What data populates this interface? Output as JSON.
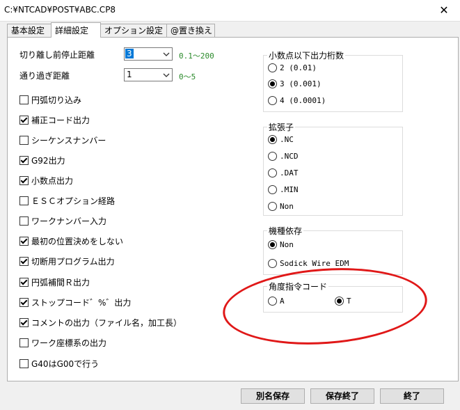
{
  "window": {
    "title": "C:¥NTCAD¥POST¥ABC.CP8",
    "close_glyph": "✕"
  },
  "tabs": [
    {
      "label": "基本設定",
      "active": false
    },
    {
      "label": "詳細設定",
      "active": true
    },
    {
      "label": "オプション設定",
      "active": false
    },
    {
      "label": "@置き換え",
      "active": false
    }
  ],
  "fields": {
    "cut_stop_distance": {
      "label": "切り離し前停止距離",
      "value": "3",
      "range": "0.1～200"
    },
    "overshoot_distance": {
      "label": "通り過ぎ距離",
      "value": "1",
      "range": "0～5"
    }
  },
  "checkboxes": [
    {
      "label": "円弧切り込み",
      "checked": false
    },
    {
      "label": "補正コード出力",
      "checked": true
    },
    {
      "label": "シーケンスナンバー",
      "checked": false
    },
    {
      "label": "G92出力",
      "checked": true
    },
    {
      "label": "小数点出力",
      "checked": true
    },
    {
      "label": "ＥＳＣオプション経路",
      "checked": false
    },
    {
      "label": "ワークナンバー入力",
      "checked": false
    },
    {
      "label": "最初の位置決めをしない",
      "checked": true
    },
    {
      "label": "切断用プログラム出力",
      "checked": true
    },
    {
      "label": "円弧補間Ｒ出力",
      "checked": true
    },
    {
      "label": "ストップコード゛%゛出力",
      "checked": true
    },
    {
      "label": "コメントの出力（ファイル名，加工長）",
      "checked": true
    },
    {
      "label": "ワーク座標系の出力",
      "checked": false
    },
    {
      "label": "G40はG00で行う",
      "checked": false
    }
  ],
  "decimal_group": {
    "title": "小数点以下出力桁数",
    "options": [
      {
        "label": "2 (0.01)",
        "selected": false
      },
      {
        "label": "3 (0.001)",
        "selected": true
      },
      {
        "label": "4 (0.0001)",
        "selected": false
      }
    ]
  },
  "extension_group": {
    "title": "拡張子",
    "options": [
      {
        "label": ".NC",
        "selected": true
      },
      {
        "label": ".NCD",
        "selected": false
      },
      {
        "label": ".DAT",
        "selected": false
      },
      {
        "label": ".MIN",
        "selected": false
      },
      {
        "label": "Non",
        "selected": false
      }
    ]
  },
  "machine_group": {
    "title": "機種依存",
    "options": [
      {
        "label": "Non",
        "selected": true
      },
      {
        "label": "Sodick Wire EDM",
        "selected": false
      }
    ]
  },
  "angle_group": {
    "title": "角度指令コード",
    "options": [
      {
        "label": "A",
        "selected": false
      },
      {
        "label": "T",
        "selected": true
      }
    ]
  },
  "buttons": {
    "save_as": "別名保存",
    "save_exit": "保存終了",
    "exit": "終了"
  },
  "colors": {
    "annotation": "#e01818",
    "range_text": "#2a8a2a",
    "selection": "#0078d7"
  }
}
